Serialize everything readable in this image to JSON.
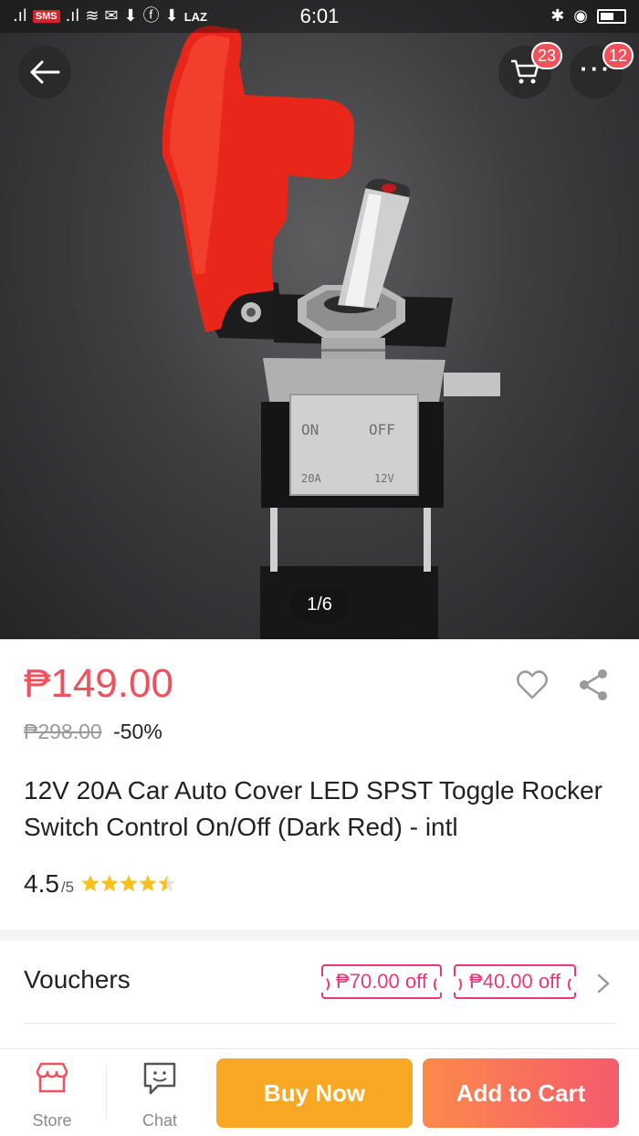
{
  "status_bar": {
    "time": "6:01",
    "carrier_badge": "SMS",
    "laz_label": "LAZ"
  },
  "header": {
    "cart_count": "23",
    "more_count": "12"
  },
  "gallery": {
    "page_indicator": "1/6",
    "switch_labels": {
      "on": "ON",
      "off": "OFF",
      "amp": "20A",
      "volt": "12V"
    }
  },
  "product": {
    "price": "₱149.00",
    "original_price": "₱298.00",
    "discount": "-50%",
    "title": "12V 20A Car Auto Cover LED SPST Toggle Rocker Switch Control On/Off (Dark Red) - intl",
    "rating": "4.5",
    "rating_max": "/5",
    "rating_fraction": 0.9
  },
  "vouchers": {
    "label": "Vouchers",
    "items": [
      "₱70.00 off",
      "₱40.00 off"
    ]
  },
  "bottom_bar": {
    "store_label": "Store",
    "chat_label": "Chat",
    "buy_now_label": "Buy Now",
    "add_to_cart_label": "Add to Cart"
  },
  "colors": {
    "price": "#f0515c",
    "voucher": "#e5397a",
    "buy_now": "#f9a825",
    "add_to_cart_start": "#fc8a4a",
    "add_to_cart_end": "#f65a6c",
    "star": "#f7c31b"
  }
}
